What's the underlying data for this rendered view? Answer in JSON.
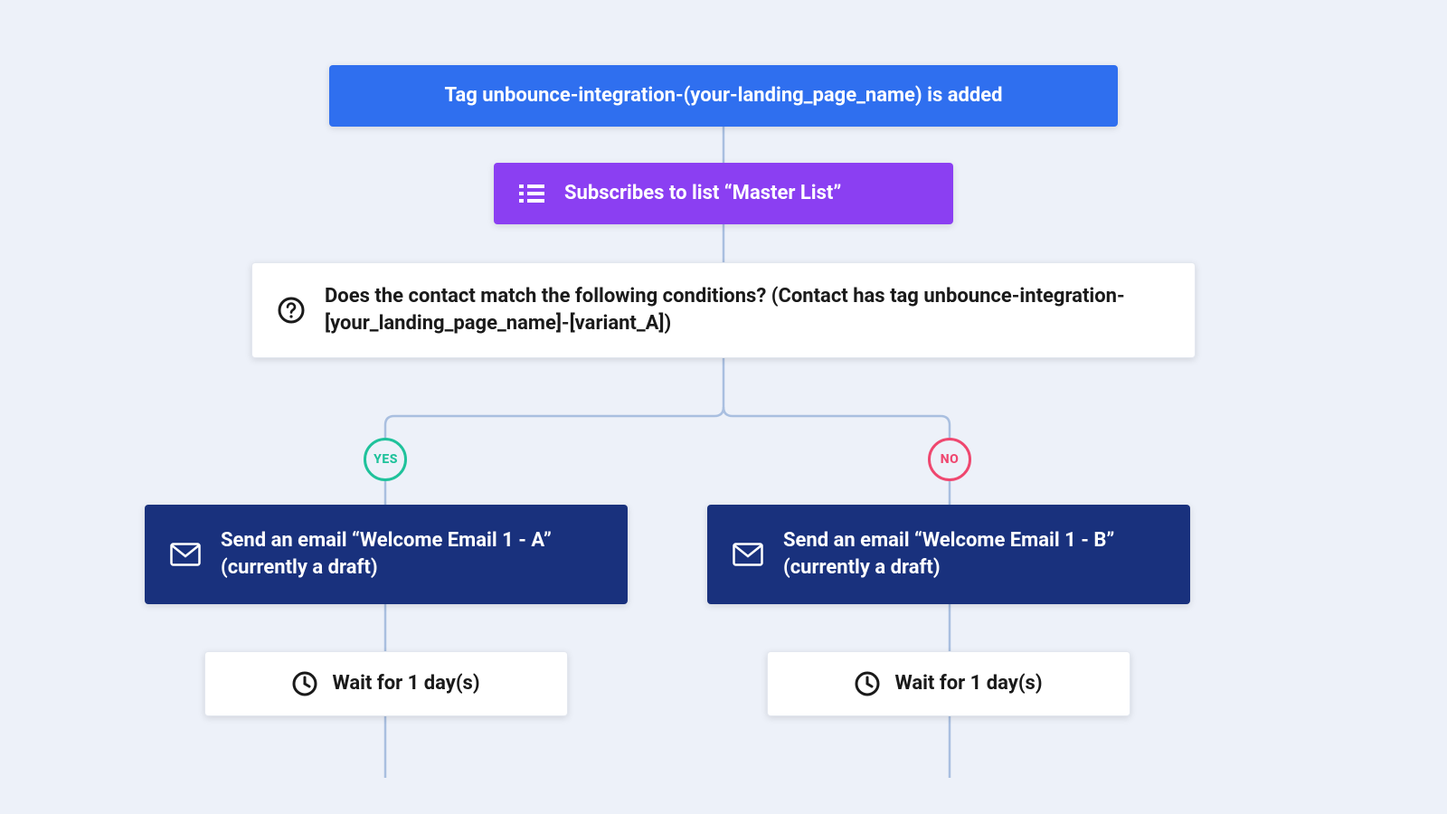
{
  "trigger": {
    "label": "Tag unbounce-integration-(your-landing_page_name) is added"
  },
  "subscribe": {
    "label": "Subscribes to list “Master List”",
    "icon": "list-icon"
  },
  "condition": {
    "label": "Does the contact match the following conditions? (Contact has tag unbounce-integration-[your_landing_page_name]-[variant_A])",
    "icon": "question-icon"
  },
  "branches": {
    "yes": {
      "badge": "YES",
      "email": {
        "label": "Send an email “Welcome Email 1 - A” (currently a draft)",
        "icon": "envelope-icon"
      },
      "wait": {
        "label": "Wait for 1 day(s)",
        "icon": "clock-icon"
      }
    },
    "no": {
      "badge": "NO",
      "email": {
        "label": "Send an email “Welcome Email 1 - B” (currently a draft)",
        "icon": "envelope-icon"
      },
      "wait": {
        "label": "Wait for 1 day(s)",
        "icon": "clock-icon"
      }
    }
  },
  "colors": {
    "trigger": "#2f6fef",
    "subscribe": "#8b3ff2",
    "email": "#19317d",
    "yes": "#1fc29b",
    "no": "#ef476f"
  }
}
